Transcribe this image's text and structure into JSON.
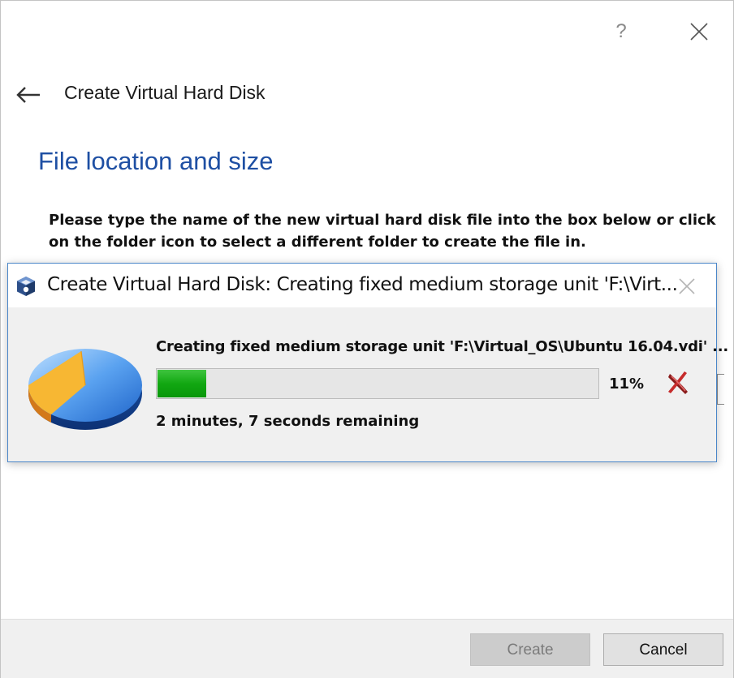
{
  "wizard": {
    "help_label": "?",
    "title": "Create Virtual Hard Disk",
    "heading": "File location and size",
    "description": "Please type the name of the new virtual hard disk file into the box below or click on the folder icon to select a different folder to create the file in.",
    "icons": {
      "back": "arrow-left-icon",
      "close": "close-icon",
      "help": "help-icon"
    },
    "colors": {
      "heading": "#1e4fa3",
      "footer_bg": "#f0f0f0"
    }
  },
  "progress_dialog": {
    "title": "Create Virtual Hard Disk: Creating fixed medium storage unit 'F:\\Virt...",
    "status": "Creating fixed medium storage unit 'F:\\Virtual_OS\\Ubuntu 16.04.vdi' ...",
    "progress_fraction": 0.11,
    "percent_label": "11%",
    "remaining": "2 minutes, 7 seconds remaining",
    "icons": {
      "app": "virtualbox-icon",
      "close": "close-icon",
      "disk": "disk-pie-icon",
      "cancel": "cancel-x-icon"
    },
    "colors": {
      "bar_fill": "#12a812",
      "border": "#4a86c8"
    }
  },
  "footer": {
    "create_label": "Create",
    "cancel_label": "Cancel",
    "create_enabled": false
  }
}
